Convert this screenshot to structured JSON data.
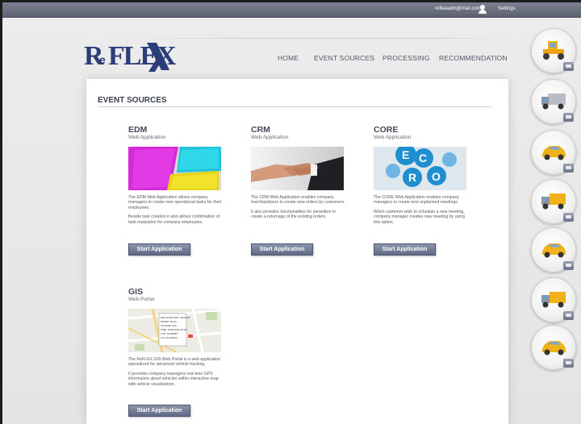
{
  "topbar": {
    "email": "refleaadm@mail.com",
    "settings": "Settings"
  },
  "logo": {
    "r": "R",
    "e": "e",
    "flex": "FLEX"
  },
  "nav": {
    "items": [
      "HOME",
      "EVENT SOURCES",
      "PROCESSING",
      "RECOMMENDATION"
    ]
  },
  "page": {
    "title": "EVENT SOURCES"
  },
  "cards": [
    {
      "title": "EDM",
      "subtitle": "Web Application",
      "desc1": "The EDM Web Application allows company managers to create new operational tasks for their employees.",
      "desc2": "Beside task creation it also allows confirmation of task realization for company employees.",
      "button": "Start Application"
    },
    {
      "title": "CRM",
      "subtitle": "Web Application",
      "desc1": "The CRM Web Application enables company merchandisers to create new orders by customers.",
      "desc2": "It also provides functionalities for presellers to create a returnage of the existing orders.",
      "button": "Start Application"
    },
    {
      "title": "CORE",
      "subtitle": "Web Application",
      "desc1": "The CORE Web Application enables company managers to create new unplanned meetings.",
      "desc2": "When customer wish to schedule a new meeting, company manager creates new meeting by using this option.",
      "button": "Start Application"
    },
    {
      "title": "GIS",
      "subtitle": "Web Portal",
      "desc1": "The ReFLEX GIS Web Portal is a web application specialized for advanced vehicle tracking.",
      "desc2": "It provides company managers real time GPS information about vehicles within interactive map with vehicle visualization.",
      "button": "Start Application"
    }
  ],
  "core_thumb_letters": [
    "E",
    "C",
    "O",
    "R"
  ],
  "gis_popup": {
    "lines": [
      "REGISTRATION: UE0211P",
      "SPEED: 0km/h",
      "COURSE: 260",
      "TIME: 16/02/2013 09:04",
      "LON: 19.835807",
      "LAT: 45.254143"
    ]
  },
  "colors": {
    "topbar": "#6b7180",
    "logo": "#2a3d78",
    "button": "#6f7a93",
    "car": "#f0b21a",
    "truck": "#9ea4ad"
  },
  "vehicles": [
    {
      "type": "roller-icon"
    },
    {
      "type": "truck-icon"
    },
    {
      "type": "car-icon"
    },
    {
      "type": "truck-icon"
    },
    {
      "type": "car-icon"
    },
    {
      "type": "truck-icon"
    },
    {
      "type": "car-icon"
    }
  ]
}
